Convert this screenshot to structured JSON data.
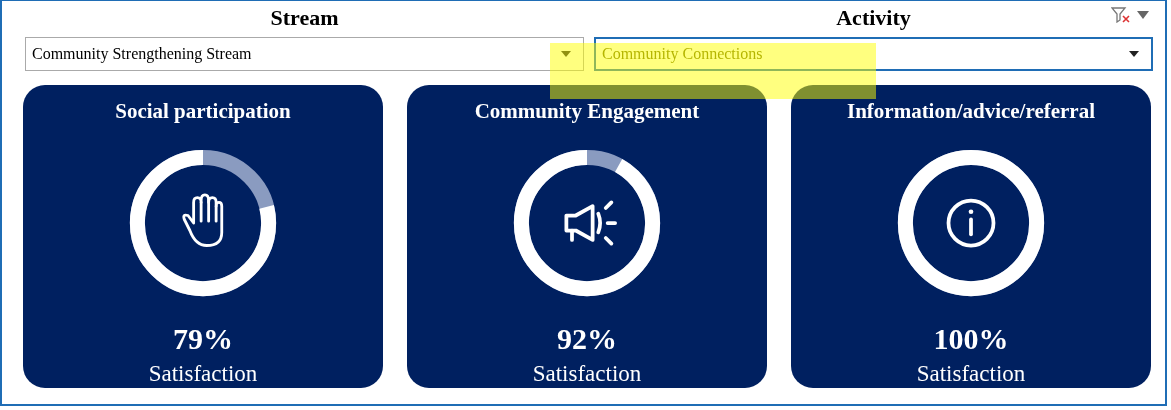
{
  "filters": [
    {
      "label": "Stream",
      "value": "Community Strengthening Stream",
      "focused": false
    },
    {
      "label": "Activity",
      "value": "Community Connections",
      "focused": true
    }
  ],
  "cards": [
    {
      "title": "Social participation",
      "kind": "hand",
      "level": 0.79,
      "percent": "79%",
      "caption": "Satisfaction"
    },
    {
      "title": "Community Engagement",
      "kind": "megaphone",
      "level": 0.92,
      "percent": "92%",
      "caption": "Satisfaction"
    },
    {
      "title": "Information/advice/referral",
      "kind": "info",
      "level": 1,
      "percent": "100%",
      "caption": "Satisfaction"
    }
  ]
}
